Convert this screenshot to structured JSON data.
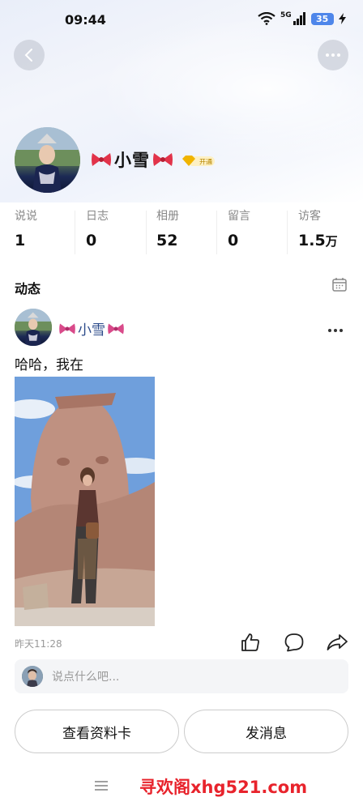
{
  "status_bar": {
    "time": "09:44",
    "network": "5G",
    "battery": "35"
  },
  "profile": {
    "name": "小雪",
    "vip_badge": "开通"
  },
  "stats": [
    {
      "label": "说说",
      "value": "1",
      "unit": ""
    },
    {
      "label": "日志",
      "value": "0",
      "unit": ""
    },
    {
      "label": "相册",
      "value": "52",
      "unit": ""
    },
    {
      "label": "留言",
      "value": "0",
      "unit": ""
    },
    {
      "label": "访客",
      "value": "1.5",
      "unit": "万"
    }
  ],
  "feed": {
    "section_title": "动态",
    "post": {
      "author": "小雪",
      "text": "哈哈，我在",
      "time": "昨天11:28"
    }
  },
  "comment": {
    "placeholder": "说点什么吧..."
  },
  "buttons": {
    "profile_card": "查看资料卡",
    "send_message": "发消息"
  },
  "watermark": "寻欢阁xhg521.com",
  "colors": {
    "accent_blue": "#4e86ea",
    "name_blue": "#2b4a8a",
    "watermark_red": "#e8232c",
    "badge_gold": "#f0b400"
  }
}
